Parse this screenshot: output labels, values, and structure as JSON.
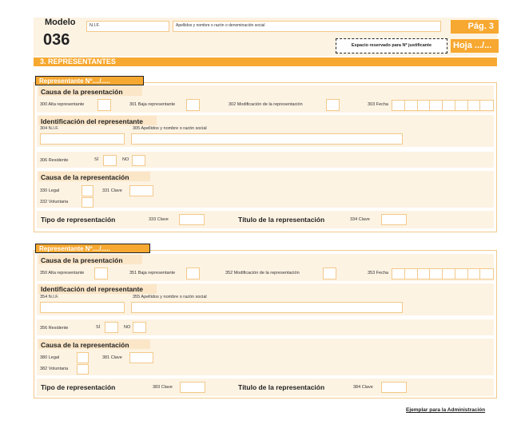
{
  "header": {
    "modelo_label": "Modelo",
    "modelo_number": "036",
    "nif_label": "N.I.F.",
    "name_label": "Apellidos y nombre o razón o denominación social",
    "page_label": "Pág. 3",
    "sheet_label": "Hoja .../...",
    "reserved_label": "Espacio reservado para Nº justificante"
  },
  "section": {
    "title": "3. REPRESENTANTES"
  },
  "rep1": {
    "tag": "Representante Nº..../.....",
    "causa_presentacion": "Causa de la presentación",
    "f300": "300 Alta representante",
    "f301": "301 Baja representante",
    "f302": "302 Modificación de la representación",
    "f303": "303 Fecha",
    "identificacion": "Identificación del representante",
    "f304": "304 N.I.F.",
    "f305": "305 Apellidos y nombre o razón social",
    "f306": "306 Residente",
    "si": "SÍ",
    "no": "NO",
    "causa_representacion": "Causa de la representación",
    "f330": "330 Legal",
    "f331": "331 Clave",
    "f332": "332 Voluntaria",
    "tipo": "Tipo de representación",
    "f333": "333 Clave",
    "titulo": "Título de la representación",
    "f334": "334 Clave"
  },
  "rep2": {
    "tag": "Representante Nº..../.....",
    "causa_presentacion": "Causa de la presentación",
    "f350": "350 Alta representante",
    "f351": "351 Baja representante",
    "f352": "352 Modificación de la representación",
    "f353": "353 Fecha",
    "identificacion": "Identificación del representante",
    "f354": "354 N.I.F.",
    "f355": "355 Apellidos y nombre o razón social",
    "f356": "356 Residente",
    "si": "SÍ",
    "no": "NO",
    "causa_representacion": "Causa de la representación",
    "f380": "380 Legal",
    "f381": "381 Clave",
    "f382": "382 Voluntaria",
    "tipo": "Tipo de representación",
    "f383": "383 Clave",
    "titulo": "Título de la representación",
    "f384": "384 Clave"
  },
  "footer": {
    "text": "Ejemplar para la Administración"
  },
  "colors": {
    "accent": "#f7a830",
    "pale": "#fdf3e3",
    "border": "#f2c98a"
  }
}
